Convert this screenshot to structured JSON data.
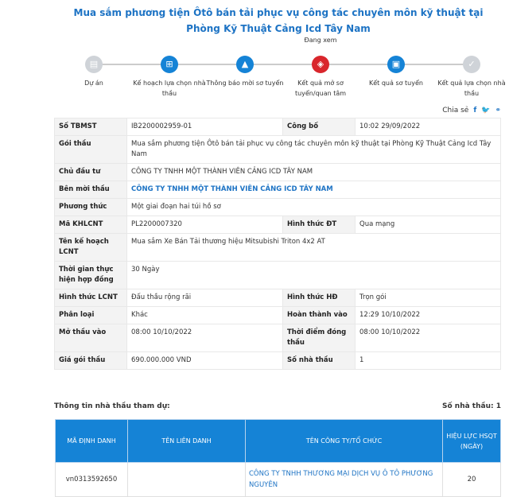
{
  "title": "Mua sắm phương tiện Ôtô bán tải phục vụ công tác chuyên môn kỹ thuật tại Phòng Kỹ Thuật Cảng Icd Tây Nam",
  "steps": [
    {
      "label": "Dự án",
      "icon": "clipboard-icon",
      "color": "#cfd3d8"
    },
    {
      "label": "Kế hoạch lựa chọn nhà thầu",
      "icon": "sitemap-icon",
      "color": "#1583d6"
    },
    {
      "label": "Thông báo mời sơ tuyển",
      "icon": "bell-icon",
      "color": "#1583d6"
    },
    {
      "label": "Kết quả mở sơ tuyển/quan tâm",
      "icon": "clipboard-shield-icon",
      "color": "#d9262c",
      "current": "Đang xem"
    },
    {
      "label": "Kết quả sơ tuyển",
      "icon": "clipboard-check-icon",
      "color": "#1583d6"
    },
    {
      "label": "Kết quả lựa chọn nhà thầu",
      "icon": "badge-check-icon",
      "color": "#cfd3d8"
    }
  ],
  "share": {
    "label": "Chia sẻ"
  },
  "info": {
    "so_tbmst_l": "Số TBMST",
    "so_tbmst": "IB2200002959-01",
    "cong_bo_l": "Công bố",
    "cong_bo": "10:02 29/09/2022",
    "goi_thau_l": "Gói thầu",
    "goi_thau": "Mua sắm phương tiện Ôtô bán tải phục vụ công tác chuyên môn kỹ thuật tại Phòng Kỹ Thuật Cảng Icd Tây Nam",
    "chu_dau_tu_l": "Chủ đầu tư",
    "chu_dau_tu": "CÔNG TY TNHH MỘT THÀNH VIÊN CẢNG ICD TÂY NAM",
    "ben_moi_thau_l": "Bên mời thầu",
    "ben_moi_thau": "CÔNG TY TNHH MỘT THÀNH VIÊN CẢNG ICD TÂY NAM",
    "phuong_thuc_l": "Phương thức",
    "phuong_thuc": "Một giai đoạn hai túi hồ sơ",
    "ma_khlcnt_l": "Mã KHLCNT",
    "ma_khlcnt": "PL2200007320",
    "hinh_thuc_dt_l": "Hình thức ĐT",
    "hinh_thuc_dt": "Qua mạng",
    "ten_kh_l": "Tên kế hoạch LCNT",
    "ten_kh": "Mua sắm Xe Bán Tải thương hiệu Mitsubishi Triton 4x2 AT",
    "thoi_gian_l": "Thời gian thực hiện hợp đồng",
    "thoi_gian": "30 Ngày",
    "hinh_thuc_lcnt_l": "Hình thức LCNT",
    "hinh_thuc_lcnt": "Đấu thầu rộng rãi",
    "hinh_thuc_hd_l": "Hình thức HĐ",
    "hinh_thuc_hd": "Trọn gói",
    "phan_loai_l": "Phân loại",
    "phan_loai": "Khác",
    "hoan_thanh_l": "Hoàn thành vào",
    "hoan_thanh": "12:29 10/10/2022",
    "mo_thau_l": "Mở thầu vào",
    "mo_thau": "08:00 10/10/2022",
    "dong_thau_l": "Thời điểm đóng thầu",
    "dong_thau": "08:00 10/10/2022",
    "gia_l": "Giá gói thầu",
    "gia": "690.000.000 VND",
    "so_nt_l": "Số nhà thầu",
    "so_nt": "1"
  },
  "bidders": {
    "heading": "Thông tin nhà thầu tham dự:",
    "count": "Số nhà thầu: 1",
    "columns": [
      "MÃ ĐỊNH DANH",
      "TÊN LIÊN DANH",
      "TÊN CÔNG TY/TỔ CHỨC",
      "HIỆU LỰC HSQT (NGÀY)"
    ],
    "rows": [
      {
        "id": "vn0313592650",
        "joint": "",
        "company": "CÔNG TY TNHH THƯƠNG MẠI DỊCH VỤ Ô TÔ PHƯƠNG NGUYÊN",
        "validity": "20"
      }
    ]
  }
}
